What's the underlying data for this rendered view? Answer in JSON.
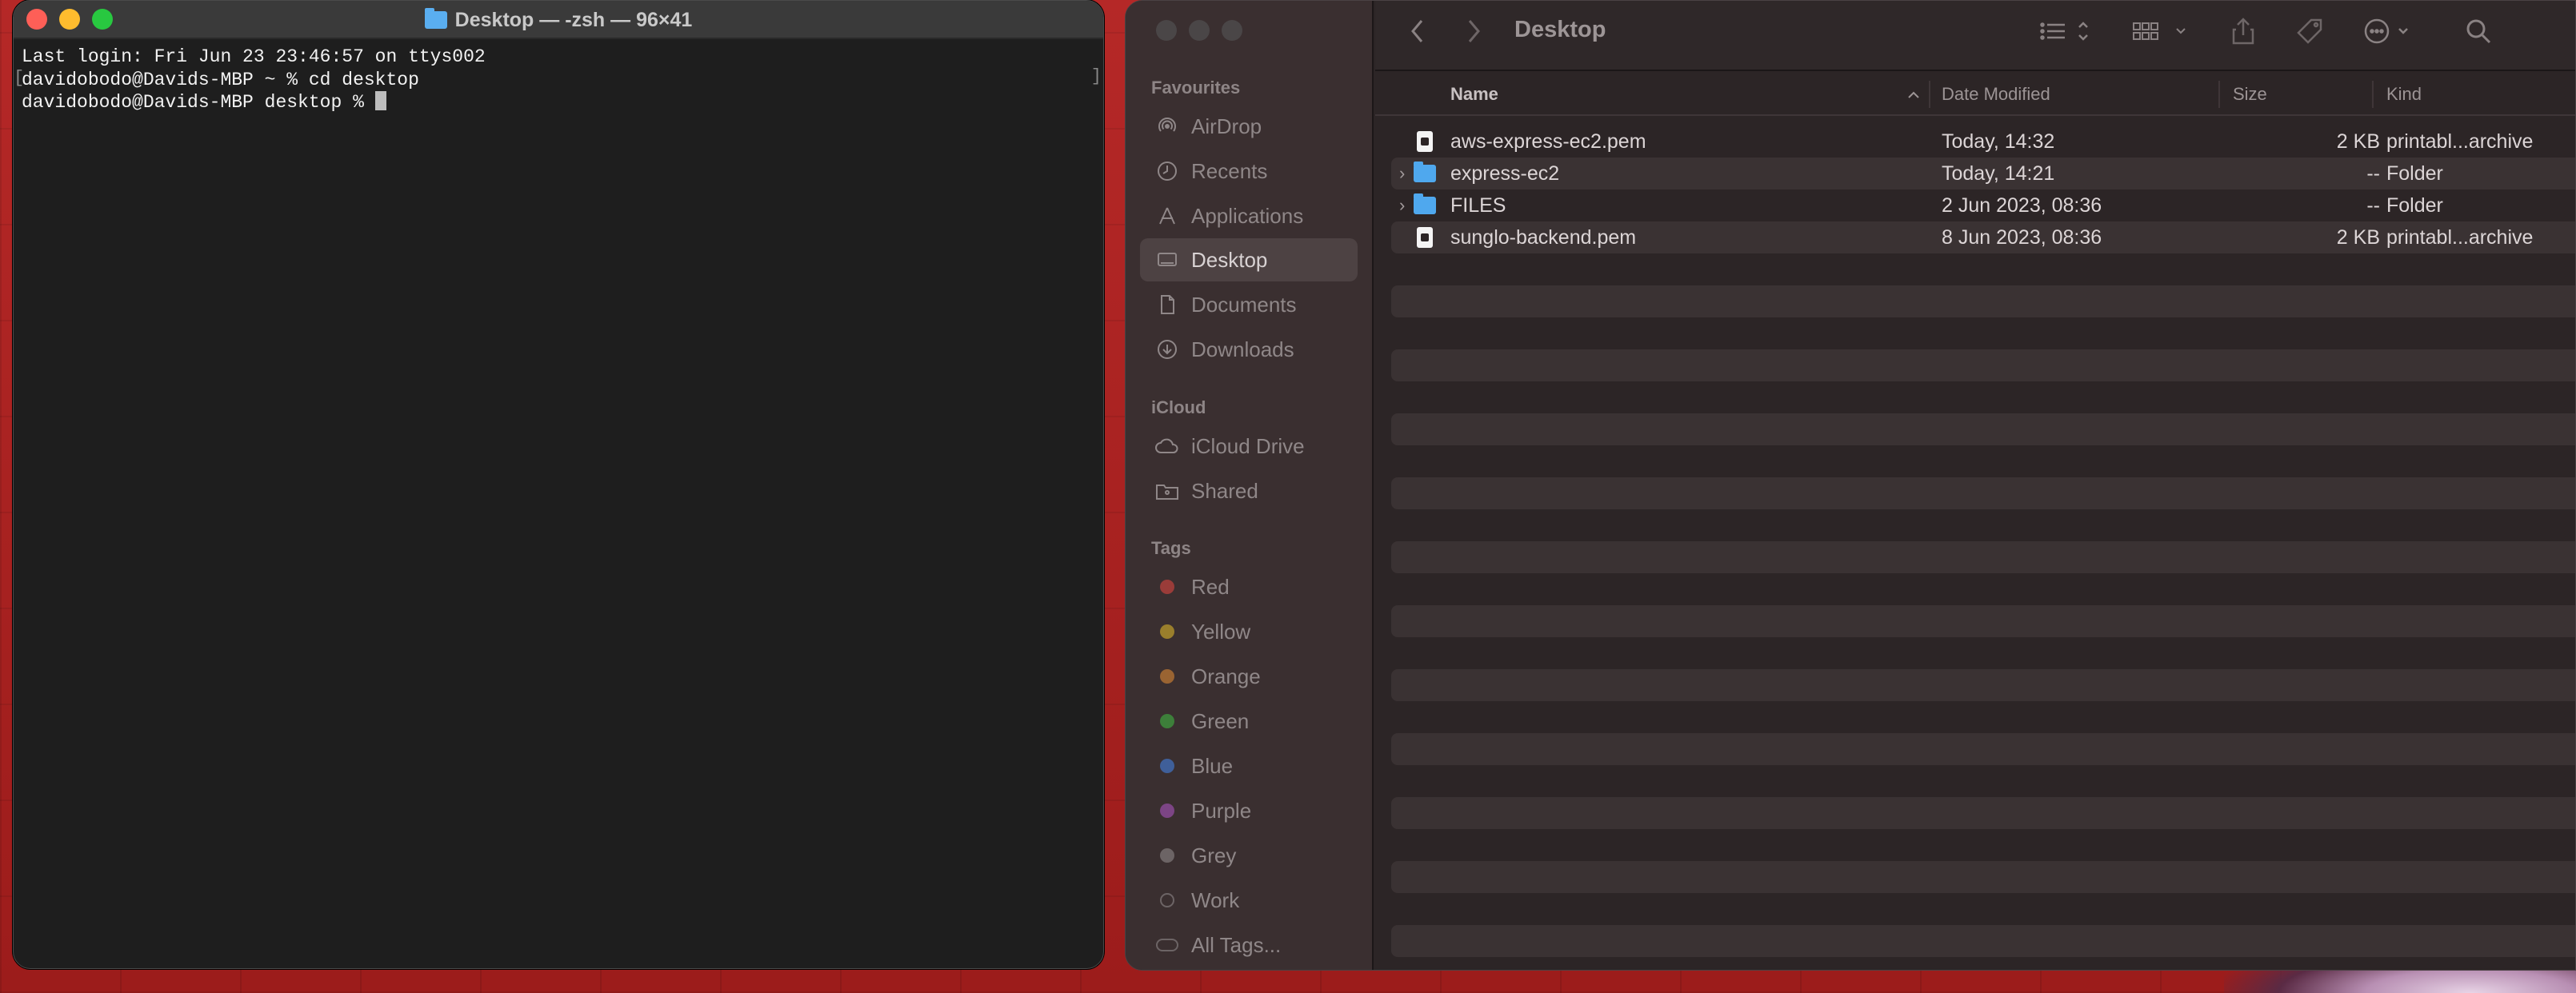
{
  "terminal": {
    "title": "Desktop — -zsh — 96×41",
    "lines": [
      "Last login: Fri Jun 23 23:46:57 on ttys002",
      "davidobodo@Davids-MBP ~ % cd desktop",
      "davidobodo@Davids-MBP desktop % "
    ]
  },
  "finder": {
    "toolbar": {
      "title": "Desktop",
      "back_icon": "chevron-left-icon",
      "forward_icon": "chevron-right-icon"
    },
    "sidebar": {
      "favourites_label": "Favourites",
      "favourites": [
        {
          "label": "AirDrop",
          "icon": "airdrop-icon"
        },
        {
          "label": "Recents",
          "icon": "clock-icon"
        },
        {
          "label": "Applications",
          "icon": "applications-icon"
        },
        {
          "label": "Desktop",
          "icon": "desktop-icon",
          "selected": true
        },
        {
          "label": "Documents",
          "icon": "document-icon"
        },
        {
          "label": "Downloads",
          "icon": "download-icon"
        }
      ],
      "icloud_label": "iCloud",
      "icloud": [
        {
          "label": "iCloud Drive",
          "icon": "cloud-icon"
        },
        {
          "label": "Shared",
          "icon": "shared-folder-icon"
        }
      ],
      "tags_label": "Tags",
      "tags": [
        {
          "label": "Red",
          "color": "#e0443e"
        },
        {
          "label": "Yellow",
          "color": "#e5b922"
        },
        {
          "label": "Orange",
          "color": "#f09230"
        },
        {
          "label": "Green",
          "color": "#3cb54a"
        },
        {
          "label": "Blue",
          "color": "#3a82e0"
        },
        {
          "label": "Purple",
          "color": "#b05cc6"
        },
        {
          "label": "Grey",
          "color": "#8e8e8e"
        },
        {
          "label": "Work",
          "color": ""
        },
        {
          "label": "All Tags...",
          "color": ""
        }
      ]
    },
    "columns": {
      "name": "Name",
      "date": "Date Modified",
      "size": "Size",
      "kind": "Kind"
    },
    "files": [
      {
        "name": "aws-express-ec2.pem",
        "date": "Today, 14:32",
        "size": "2 KB",
        "kind": "printabl...archive",
        "type": "file"
      },
      {
        "name": "express-ec2",
        "date": "Today, 14:21",
        "size": "--",
        "kind": "Folder",
        "type": "folder"
      },
      {
        "name": "FILES",
        "date": "2 Jun 2023, 08:36",
        "size": "--",
        "kind": "Folder",
        "type": "folder"
      },
      {
        "name": "sunglo-backend.pem",
        "date": "8 Jun 2023, 08:36",
        "size": "2 KB",
        "kind": "printabl...archive",
        "type": "file"
      }
    ]
  }
}
